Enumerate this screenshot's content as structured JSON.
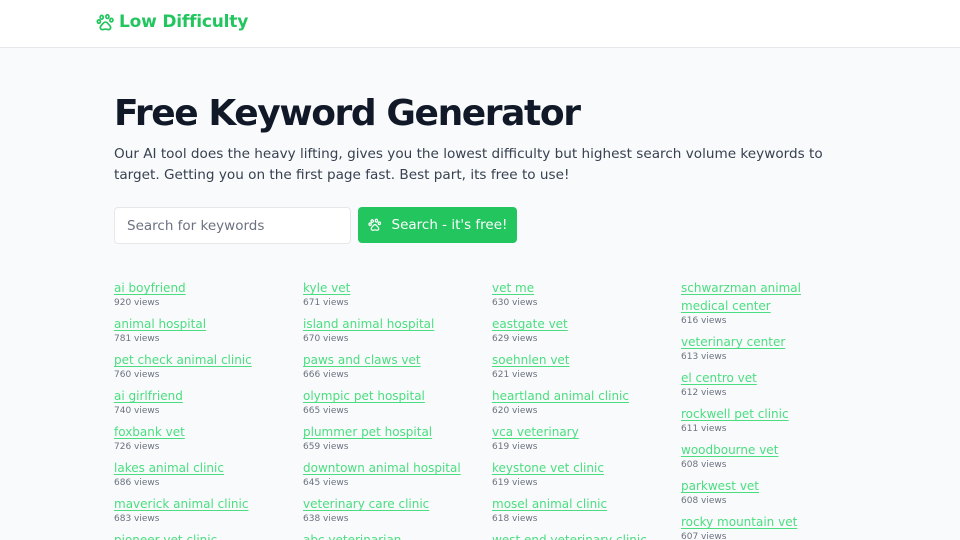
{
  "header": {
    "logo_text": "Low Difficulty",
    "logo_icon": "paw-icon",
    "brand_color": "#22c55e"
  },
  "hero": {
    "title": "Free Keyword Generator",
    "description": "Our AI tool does the heavy lifting, gives you the lowest difficulty but highest search volume keywords to target. Getting you on the first page fast. Best part, its free to use!"
  },
  "search": {
    "placeholder": "Search for keywords",
    "value": "",
    "button_label": "Search - it's free!",
    "button_icon": "paw-icon"
  },
  "keyword_columns": [
    [
      {
        "keyword": "ai boyfriend",
        "views": "920 views"
      },
      {
        "keyword": "animal hospital",
        "views": "781 views"
      },
      {
        "keyword": "pet check animal clinic",
        "views": "760 views"
      },
      {
        "keyword": "ai girlfriend",
        "views": "740 views"
      },
      {
        "keyword": "foxbank vet",
        "views": "726 views"
      },
      {
        "keyword": "lakes animal clinic",
        "views": "686 views"
      },
      {
        "keyword": "maverick animal clinic",
        "views": "683 views"
      },
      {
        "keyword": "pioneer vet clinic",
        "views": ""
      }
    ],
    [
      {
        "keyword": "kyle vet",
        "views": "671 views"
      },
      {
        "keyword": "island animal hospital",
        "views": "670 views"
      },
      {
        "keyword": "paws and claws vet",
        "views": "666 views"
      },
      {
        "keyword": "olympic pet hospital",
        "views": "665 views"
      },
      {
        "keyword": "plummer pet hospital",
        "views": "659 views"
      },
      {
        "keyword": "downtown animal hospital",
        "views": "645 views"
      },
      {
        "keyword": "veterinary care clinic",
        "views": "638 views"
      },
      {
        "keyword": "abc veterinarian",
        "views": ""
      }
    ],
    [
      {
        "keyword": "vet me",
        "views": "630 views"
      },
      {
        "keyword": "eastgate vet",
        "views": "629 views"
      },
      {
        "keyword": "soehnlen vet",
        "views": "621 views"
      },
      {
        "keyword": "heartland animal clinic",
        "views": "620 views"
      },
      {
        "keyword": "vca veterinary",
        "views": "619 views"
      },
      {
        "keyword": "keystone vet clinic",
        "views": "619 views"
      },
      {
        "keyword": "mosel animal clinic",
        "views": "618 views"
      },
      {
        "keyword": "west end veterinary clinic",
        "views": ""
      }
    ],
    [
      {
        "keyword": "schwarzman animal medical center",
        "views": "616 views"
      },
      {
        "keyword": "veterinary center",
        "views": "613 views"
      },
      {
        "keyword": "el centro vet",
        "views": "612 views"
      },
      {
        "keyword": "rockwell pet clinic",
        "views": "611 views"
      },
      {
        "keyword": "woodbourne vet",
        "views": "608 views"
      },
      {
        "keyword": "parkwest vet",
        "views": "608 views"
      },
      {
        "keyword": "rocky mountain vet",
        "views": "607 views"
      }
    ]
  ]
}
